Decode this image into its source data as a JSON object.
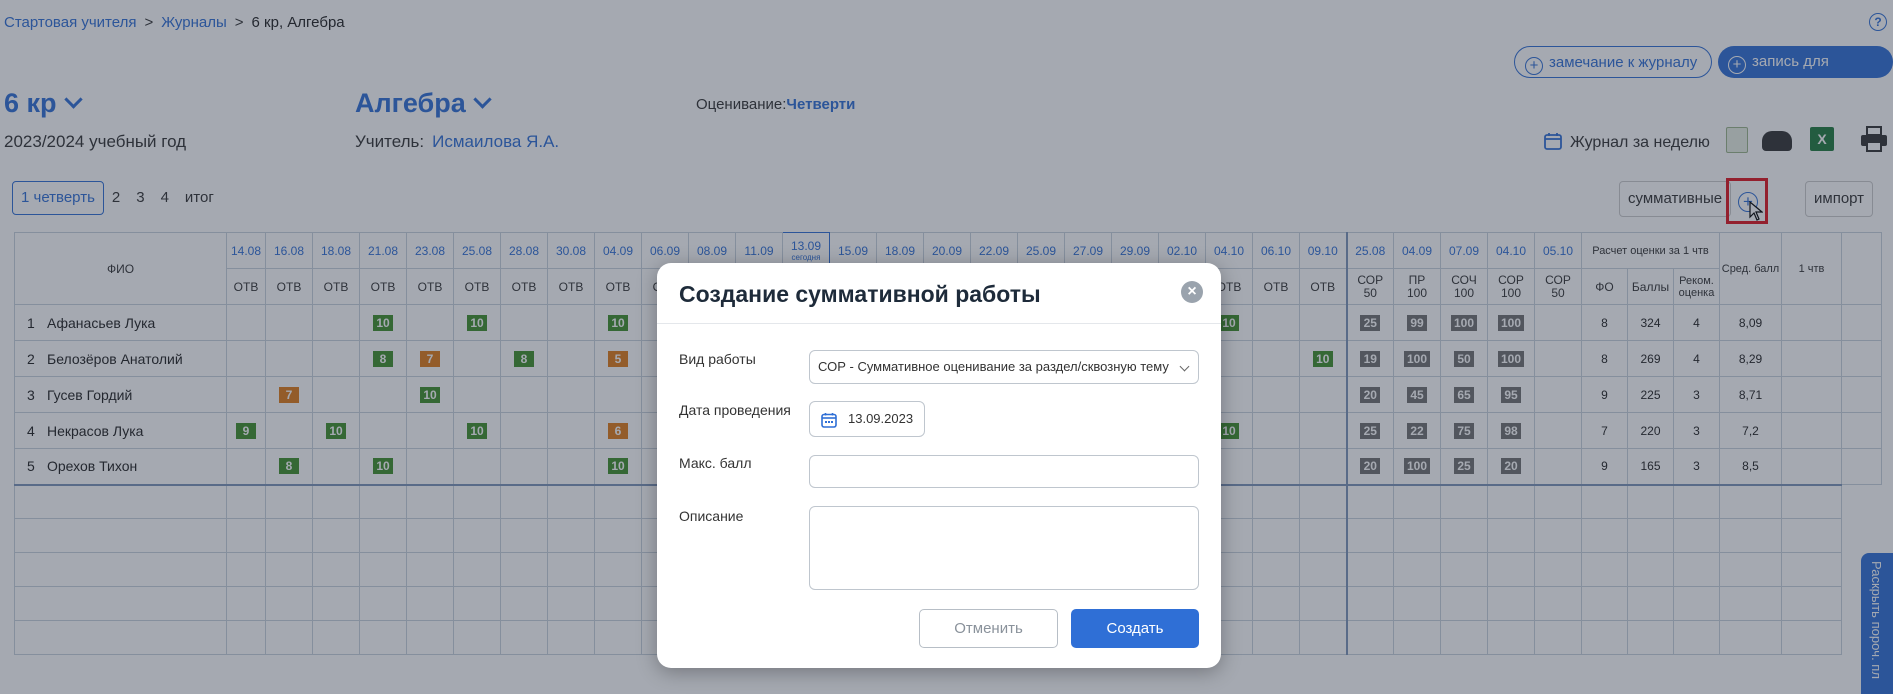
{
  "breadcrumb": {
    "item1": "Стартовая учителя",
    "item2": "Журналы",
    "current": "6 кр, Алгебра"
  },
  "header": {
    "remark_button": "замечание к журналу",
    "record_button": "запись для класса",
    "class_name": "6 кр",
    "subject_name": "Алгебра",
    "school_year": "2023/2024 учебный год",
    "teacher_label": "Учитель:",
    "teacher_name": "Исмаилова Я.А.",
    "grading_label": "Оценивание:",
    "grading_value": "Четверти",
    "week_journal": "Журнал за неделю"
  },
  "tabs": [
    "1 четверть",
    "2",
    "3",
    "4",
    "итог"
  ],
  "toolbar": {
    "summative_label": "суммативные",
    "import_label": "импорт"
  },
  "table": {
    "fio_header": "ФИО",
    "today_label": "сегодня",
    "dates": [
      "14.08",
      "16.08",
      "18.08",
      "21.08",
      "23.08",
      "25.08",
      "28.08",
      "30.08",
      "04.09",
      "06.09",
      "08.09",
      "11.09",
      "13.09",
      "15.09",
      "18.09",
      "20.09",
      "22.09",
      "25.09",
      "27.09",
      "29.09",
      "02.10",
      "04.10",
      "06.10",
      "09.10"
    ],
    "work_type": "ОТВ",
    "sum_cols": [
      {
        "date": "25.08",
        "type": "СОР",
        "max": "50"
      },
      {
        "date": "04.09",
        "type": "ПР",
        "max": "100"
      },
      {
        "date": "07.09",
        "type": "СОЧ",
        "max": "100"
      },
      {
        "date": "04.10",
        "type": "СОР",
        "max": "100"
      },
      {
        "date": "05.10",
        "type": "СОР",
        "max": "50"
      }
    ],
    "calc_header": "Расчет оценки за 1 чтв",
    "calc_cols": [
      "ФО",
      "Баллы",
      "Реком. оценка"
    ],
    "avg_header": "Сред. балл",
    "q1_header": "1 чтв",
    "students": [
      {
        "num": "1",
        "name": "Афанасьев Лука",
        "sum": [
          "25",
          "99",
          "100",
          "100",
          ""
        ],
        "fo": "8",
        "points": "324",
        "rec": "4",
        "avg": "8,09"
      },
      {
        "num": "2",
        "name": "Белозёров Анатолий",
        "sum": [
          "19",
          "100",
          "50",
          "100",
          ""
        ],
        "fo": "8",
        "points": "269",
        "rec": "4",
        "avg": "8,29"
      },
      {
        "num": "3",
        "name": "Гусев Гордий",
        "sum": [
          "20",
          "45",
          "65",
          "95",
          ""
        ],
        "fo": "9",
        "points": "225",
        "rec": "3",
        "avg": "8,71"
      },
      {
        "num": "4",
        "name": "Некрасов Лука",
        "sum": [
          "25",
          "22",
          "75",
          "98",
          ""
        ],
        "fo": "7",
        "points": "220",
        "rec": "3",
        "avg": "7,2"
      },
      {
        "num": "5",
        "name": "Орехов Тихон",
        "sum": [
          "20",
          "100",
          "25",
          "20",
          ""
        ],
        "fo": "9",
        "points": "165",
        "rec": "3",
        "avg": "8,5"
      }
    ],
    "grades": [
      [
        "",
        "",
        "",
        "10",
        "",
        "10",
        "",
        "",
        "10",
        "",
        "",
        "",
        "",
        "",
        "",
        "",
        "",
        "",
        "",
        "",
        "",
        "10",
        "",
        ""
      ],
      [
        "",
        "",
        "",
        "8",
        "7",
        "",
        "8",
        "",
        "5",
        "",
        "",
        "",
        "",
        "",
        "",
        "",
        "",
        "",
        "",
        "",
        "",
        "",
        "",
        "10"
      ],
      [
        "",
        "7",
        "",
        "",
        "10",
        "",
        "",
        "",
        "",
        "",
        "",
        "",
        "",
        "",
        "",
        "",
        "",
        "",
        "",
        "",
        "",
        "",
        "",
        ""
      ],
      [
        "9",
        "",
        "10",
        "",
        "",
        "10",
        "",
        "",
        "6",
        "",
        "",
        "",
        "",
        "",
        "",
        "",
        "",
        "",
        "",
        "",
        "",
        "10",
        "",
        ""
      ],
      [
        "",
        "8",
        "",
        "10",
        "",
        "",
        "",
        "",
        "10",
        "",
        "",
        "",
        "",
        "",
        "",
        "",
        "",
        "",
        "",
        "",
        "",
        "",
        "",
        ""
      ]
    ],
    "grade_colors": [
      [
        "",
        "",
        "",
        "g",
        "",
        "g",
        "",
        "",
        "g",
        "",
        "",
        "",
        "",
        "",
        "",
        "",
        "",
        "",
        "",
        "",
        "",
        "g",
        "",
        ""
      ],
      [
        "",
        "",
        "",
        "g",
        "o",
        "",
        "g",
        "",
        "o",
        "",
        "",
        "",
        "",
        "",
        "",
        "",
        "",
        "",
        "",
        "",
        "",
        "",
        "",
        "g"
      ],
      [
        "",
        "o",
        "",
        "",
        "g",
        "",
        "",
        "",
        "",
        "",
        "",
        "",
        "",
        "",
        "",
        "",
        "",
        "",
        "",
        "",
        "",
        "",
        "",
        ""
      ],
      [
        "g",
        "",
        "g",
        "",
        "",
        "g",
        "",
        "",
        "o",
        "",
        "",
        "",
        "",
        "",
        "",
        "",
        "",
        "",
        "",
        "",
        "",
        "g",
        "",
        ""
      ],
      [
        "",
        "g",
        "",
        "g",
        "",
        "",
        "",
        "",
        "g",
        "",
        "",
        "",
        "",
        "",
        "",
        "",
        "",
        "",
        "",
        "",
        "",
        "",
        "",
        ""
      ]
    ]
  },
  "modal": {
    "title": "Создание суммативной работы",
    "work_type_label": "Вид работы",
    "work_type_value": "СОР - Суммативное оценивание за раздел/сквозную тему",
    "date_label": "Дата проведения",
    "date_value": "13.09.2023",
    "max_label": "Макс. балл",
    "max_value": "",
    "desc_label": "Описание",
    "desc_value": "",
    "cancel": "Отменить",
    "create": "Создать"
  },
  "side_panel": {
    "label": "Раскрыть порoч. пл"
  },
  "colors": {
    "accent": "#2f6fd6",
    "grade_green": "#3f8f2a",
    "grade_orange": "#e07b17",
    "highlight_red": "#e0141e"
  }
}
